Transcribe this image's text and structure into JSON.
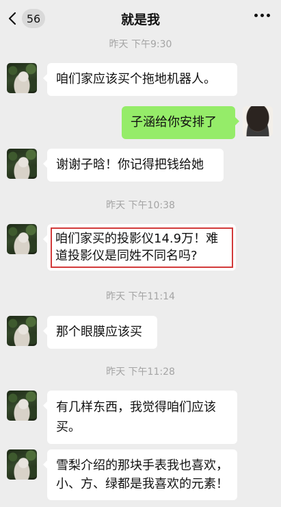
{
  "header": {
    "back_icon": "chevron-left-icon",
    "unread_count": "56",
    "title": "就是我",
    "more_icon": "more-dots-icon"
  },
  "messages": [
    {
      "type": "timestamp",
      "text": "昨天  下午9:30"
    },
    {
      "type": "message",
      "side": "left",
      "text": "咱们家应该买个拖地机器人。"
    },
    {
      "type": "message",
      "side": "right",
      "text": "子涵给你安排了"
    },
    {
      "type": "message",
      "side": "left",
      "text": "谢谢子晗！你记得把钱给她"
    },
    {
      "type": "timestamp",
      "text": "昨天  下午10:38"
    },
    {
      "type": "message",
      "side": "left",
      "text": "咱们家买的投影仪14.9万！难道投影仪是同姓不同名吗?",
      "highlighted": true,
      "highlight_color": "#d23a3a"
    },
    {
      "type": "timestamp",
      "text": "昨天  下午11:14"
    },
    {
      "type": "message",
      "side": "left",
      "text": "那个眼膜应该买"
    },
    {
      "type": "timestamp",
      "text": "昨天  下午11:28"
    },
    {
      "type": "message",
      "side": "left",
      "text": "有几样东西，我觉得咱们应该买。"
    },
    {
      "type": "message",
      "side": "left",
      "text": "雪梨介绍的那块手表我也喜欢，小、方、绿都是我喜欢的元素！"
    }
  ],
  "colors": {
    "background": "#ededed",
    "bubble_left": "#ffffff",
    "bubble_right": "#95ec69",
    "timestamp": "#a4a4a4"
  }
}
